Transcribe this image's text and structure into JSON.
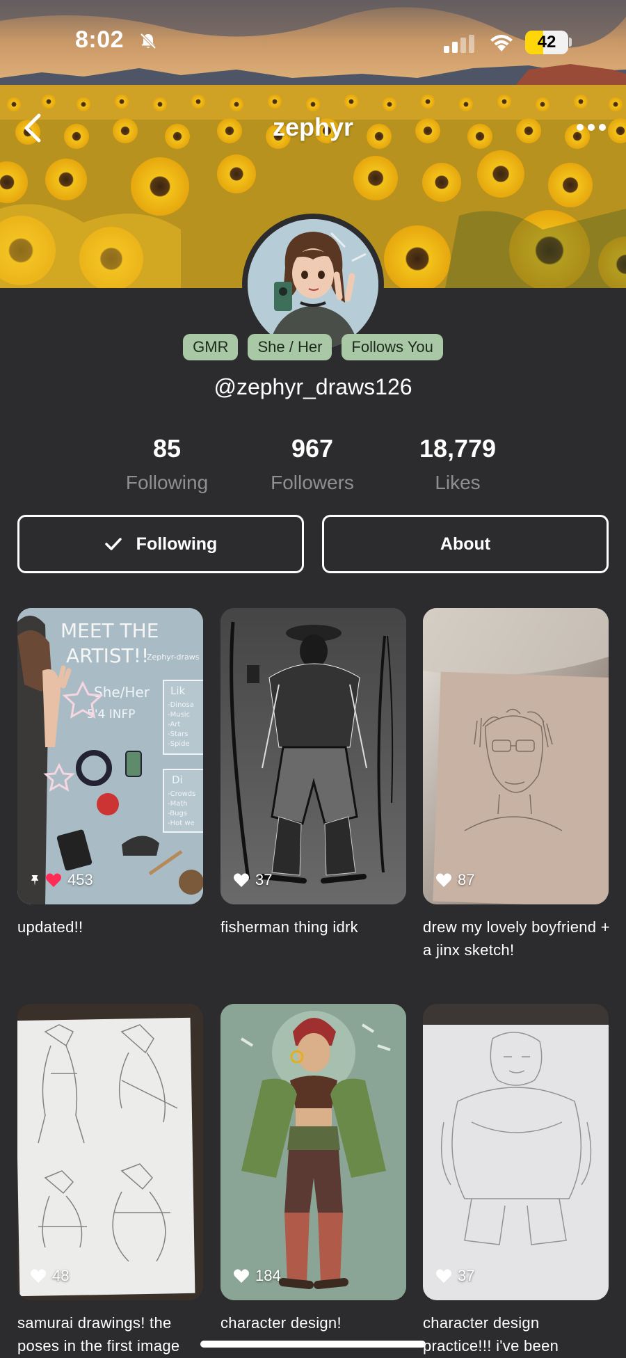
{
  "status_bar": {
    "time": "8:02",
    "battery_level": "42",
    "battery_fraction": 0.42
  },
  "nav": {
    "title": "zephyr"
  },
  "profile": {
    "pills": [
      "GMR",
      "She / Her",
      "Follows You"
    ],
    "handle": "@zephyr_draws126"
  },
  "stats": [
    {
      "value": "85",
      "label": "Following"
    },
    {
      "value": "967",
      "label": "Followers"
    },
    {
      "value": "18,779",
      "label": "Likes"
    }
  ],
  "buttons": {
    "following_label": "Following",
    "about_label": "About"
  },
  "posts": [
    {
      "likes": "453",
      "caption": "updated!!",
      "pinned": true,
      "liked": true
    },
    {
      "likes": "37",
      "caption": "fisherman thing idrk"
    },
    {
      "likes": "87",
      "caption": "drew my lovely boyfriend + a jinx sketch!"
    },
    {
      "likes": "48",
      "caption": "samurai drawings! the poses in the first image"
    },
    {
      "likes": "184",
      "caption": "character design!"
    },
    {
      "likes": "37",
      "caption": "character design practice!!! i've been"
    }
  ],
  "artwork_text": {
    "meet_title_1": "MEET THE",
    "meet_title_2": "ARTIST!!",
    "meet_sig": "Zephyr-draws",
    "pronouns": "She/Her",
    "height_mbti": "5'4 INFP",
    "likes_head": "Lik",
    "likes_list": [
      "-Dinosa",
      "-Music",
      "-Art",
      "-Stars",
      "-Spide"
    ],
    "dislikes_head": "Di",
    "dislikes_list": [
      "-Crowds",
      "-Math",
      "-Bugs",
      "-Hot we"
    ]
  },
  "colors": {
    "background": "#2c2b2e",
    "pill_bg": "#a9c8a6",
    "heart_liked": "#ff2d55",
    "muted_text": "#8f8f92"
  }
}
